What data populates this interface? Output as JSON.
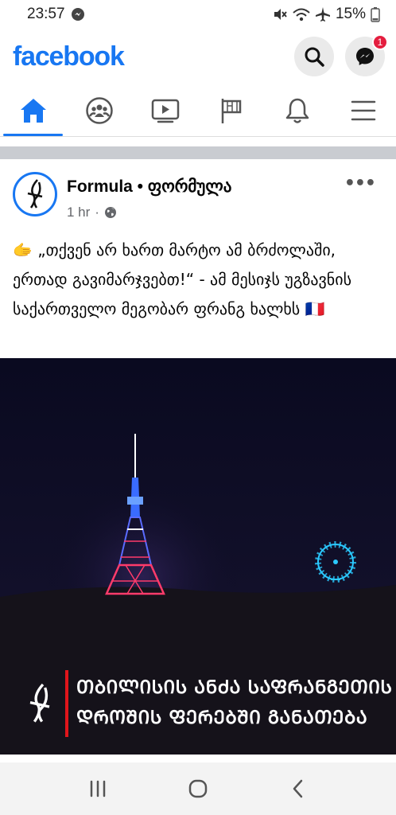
{
  "status_bar": {
    "time": "23:57",
    "battery": "15%",
    "icons": [
      "messenger-notification-icon",
      "mute-icon",
      "wifi-icon",
      "airplane-mode-icon",
      "battery-icon"
    ]
  },
  "header": {
    "brand": "facebook",
    "search_icon": "search-icon",
    "messenger_icon": "messenger-icon",
    "messenger_badge": "1",
    "brand_color": "#1877f2"
  },
  "tabs": [
    {
      "name": "home",
      "icon": "home-icon",
      "active": true
    },
    {
      "name": "groups",
      "icon": "groups-icon",
      "active": false
    },
    {
      "name": "watch",
      "icon": "video-icon",
      "active": false
    },
    {
      "name": "pages",
      "icon": "flag-icon",
      "active": false
    },
    {
      "name": "notifications",
      "icon": "bell-icon",
      "active": false
    },
    {
      "name": "menu",
      "icon": "menu-icon",
      "active": false
    }
  ],
  "post": {
    "page_name": "Formula • ფორმულა",
    "time": "1 hr",
    "privacy_icon": "globe-icon",
    "more_icon": "more-options-icon",
    "text": "🫱 „თქვენ არ ხართ მარტო ამ ბრძოლაში, ერთად გავიმარჯვებთ!“ - ამ მესიჯს უგზავნის საქართველო მეგობარ ფრანგ ხალხს 🇫🇷",
    "image_caption_line1": "ᲗᲑᲘᲚᲘᲡᲘᲡ ᲐᲜᲫᲐ ᲡᲐᲤᲠᲐᲜᲒᲔᲗᲘᲡ",
    "image_caption_line2": "ᲓᲠᲝᲨᲘᲡ ᲤᲔᲠᲔᲑᲨᲘ ᲒᲐᲜᲐᲗᲔᲑᲐ"
  },
  "nav_bar": {
    "recents_icon": "recent-apps-icon",
    "home_icon": "home-button-icon",
    "back_icon": "back-icon"
  }
}
